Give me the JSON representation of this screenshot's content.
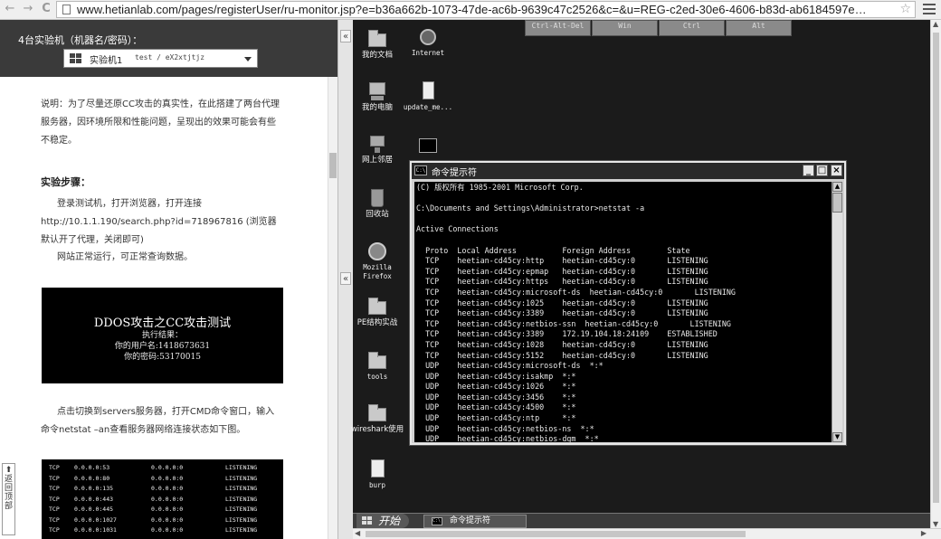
{
  "browser": {
    "back": "←",
    "forward": "→",
    "reload": "C",
    "url": "www.hetianlab.com/pages/registerUser/ru-monitor.jsp?e=b36a662b-1073-47de-ac6b-9639c47c2526&c=&u=REG-c2ed-30e6-4606-b83d-ab6184597e…",
    "star": "☆"
  },
  "lab": {
    "machines_title": "4台实验机（机器名/密码）：",
    "machine_name": "实验机1",
    "machine_cred": "test / eX2xtjtjz",
    "note": "说明：为了尽量还原CC攻击的真实性，在此搭建了两台代理服务器，因环境所限和性能问题，呈现出的效果可能会有些不稳定。",
    "steps_heading": "实验步骤：",
    "step1": "登录测试机，打开浏览器，打开连接http://10.1.1.190/search.php?id=718967816 (浏览器默认开了代理，关闭即可)",
    "step2": "网站正常运行，可正常查询数据。",
    "screenshot_title": "DDOS攻击之CC攻击测试",
    "screenshot_lines": [
      "执行结果：",
      "你的用户名:1418673631",
      "你的密码:53170015"
    ],
    "step3": "点击切换到servers服务器，打开CMD命令窗口，输入命令netstat –an查看服务器网络连接状态如下图。",
    "netstat_rows": [
      [
        "TCP",
        "0.0.0.0:53",
        "0.0.0.0:0",
        "LISTENING"
      ],
      [
        "TCP",
        "0.0.0.0:80",
        "0.0.0.0:0",
        "LISTENING"
      ],
      [
        "TCP",
        "0.0.0.0:135",
        "0.0.0.0:0",
        "LISTENING"
      ],
      [
        "TCP",
        "0.0.0.0:443",
        "0.0.0.0:0",
        "LISTENING"
      ],
      [
        "TCP",
        "0.0.0.0:445",
        "0.0.0.0:0",
        "LISTENING"
      ],
      [
        "TCP",
        "0.0.0.0:1027",
        "0.0.0.0:0",
        "LISTENING"
      ],
      [
        "TCP",
        "0.0.0.0:1031",
        "0.0.0.0:0",
        "LISTENING"
      ]
    ],
    "back_to_top": "返回顶部"
  },
  "divider": {
    "collapse_top": "«",
    "collapse_mid": "«"
  },
  "remote": {
    "keys": [
      "Ctrl-Alt-Del",
      "Win",
      "Ctrl",
      "Alt"
    ],
    "icons": {
      "my_docs": "我的文档",
      "internet": "Internet",
      "my_computer": "我的电脑",
      "update": "update_me...",
      "network": "网上邻居",
      "recycle": "回收站",
      "firefox": "Mozilla Firefox",
      "pe": "PE结构实战",
      "tools": "tools",
      "wireshark": "wireshark使用",
      "burp": "burp"
    },
    "cmd": {
      "icon_text": "C:\\",
      "title": "命令提示符",
      "min": "_",
      "max": "□",
      "close": "×",
      "lines": [
        "(C) 版权所有 1985-2001 Microsoft Corp.",
        "",
        "C:\\Documents and Settings\\Administrator>netstat -a",
        "",
        "Active Connections",
        "",
        "  Proto  Local Address          Foreign Address        State",
        "  TCP    heetian-cd45cy:http    heetian-cd45cy:0       LISTENING",
        "  TCP    heetian-cd45cy:epmap   heetian-cd45cy:0       LISTENING",
        "  TCP    heetian-cd45cy:https   heetian-cd45cy:0       LISTENING",
        "  TCP    heetian-cd45cy:microsoft-ds  heetian-cd45cy:0       LISTENING",
        "  TCP    heetian-cd45cy:1025    heetian-cd45cy:0       LISTENING",
        "  TCP    heetian-cd45cy:3389    heetian-cd45cy:0       LISTENING",
        "  TCP    heetian-cd45cy:netbios-ssn  heetian-cd45cy:0       LISTENING",
        "  TCP    heetian-cd45cy:3389    172.19.104.18:24109    ESTABLISHED",
        "  TCP    heetian-cd45cy:1028    heetian-cd45cy:0       LISTENING",
        "  TCP    heetian-cd45cy:5152    heetian-cd45cy:0       LISTENING",
        "  UDP    heetian-cd45cy:microsoft-ds  *:*",
        "  UDP    heetian-cd45cy:isakmp  *:*",
        "  UDP    heetian-cd45cy:1026    *:*",
        "  UDP    heetian-cd45cy:3456    *:*",
        "  UDP    heetian-cd45cy:4500    *:*",
        "  UDP    heetian-cd45cy:ntp     *:*",
        "  UDP    heetian-cd45cy:netbios-ns  *:*",
        "  UDP    heetian-cd45cy:netbios-dgm  *:*"
      ]
    },
    "taskbar": {
      "start": "开始",
      "task_icon": "C:\\",
      "task": "命令提示符"
    }
  }
}
